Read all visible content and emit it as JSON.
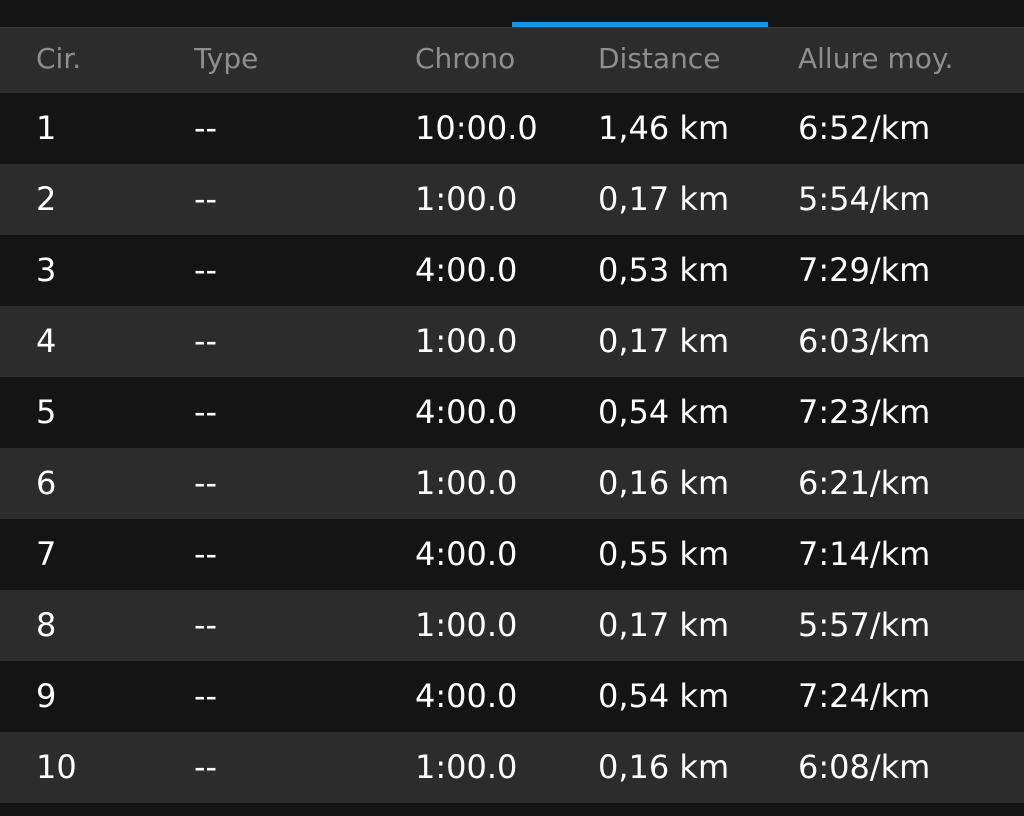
{
  "header": {
    "lap": "Cir.",
    "type": "Type",
    "time": "Chrono",
    "distance": "Distance",
    "pace": "Allure moy."
  },
  "laps": [
    {
      "lap": "1",
      "type": "--",
      "time": "10:00.0",
      "distance": "1,46 km",
      "pace": "6:52/km"
    },
    {
      "lap": "2",
      "type": "--",
      "time": "1:00.0",
      "distance": "0,17 km",
      "pace": "5:54/km"
    },
    {
      "lap": "3",
      "type": "--",
      "time": "4:00.0",
      "distance": "0,53 km",
      "pace": "7:29/km"
    },
    {
      "lap": "4",
      "type": "--",
      "time": "1:00.0",
      "distance": "0,17 km",
      "pace": "6:03/km"
    },
    {
      "lap": "5",
      "type": "--",
      "time": "4:00.0",
      "distance": "0,54 km",
      "pace": "7:23/km"
    },
    {
      "lap": "6",
      "type": "--",
      "time": "1:00.0",
      "distance": "0,16 km",
      "pace": "6:21/km"
    },
    {
      "lap": "7",
      "type": "--",
      "time": "4:00.0",
      "distance": "0,55 km",
      "pace": "7:14/km"
    },
    {
      "lap": "8",
      "type": "--",
      "time": "1:00.0",
      "distance": "0,17 km",
      "pace": "5:57/km"
    },
    {
      "lap": "9",
      "type": "--",
      "time": "4:00.0",
      "distance": "0,54 km",
      "pace": "7:24/km"
    },
    {
      "lap": "10",
      "type": "--",
      "time": "1:00.0",
      "distance": "0,16 km",
      "pace": "6:08/km"
    }
  ],
  "colors": {
    "accent": "#1e93d6",
    "header_text": "#8e8e8e",
    "row_text": "#ffffff",
    "row_dark": "#141414",
    "row_light": "#2c2c2c"
  }
}
